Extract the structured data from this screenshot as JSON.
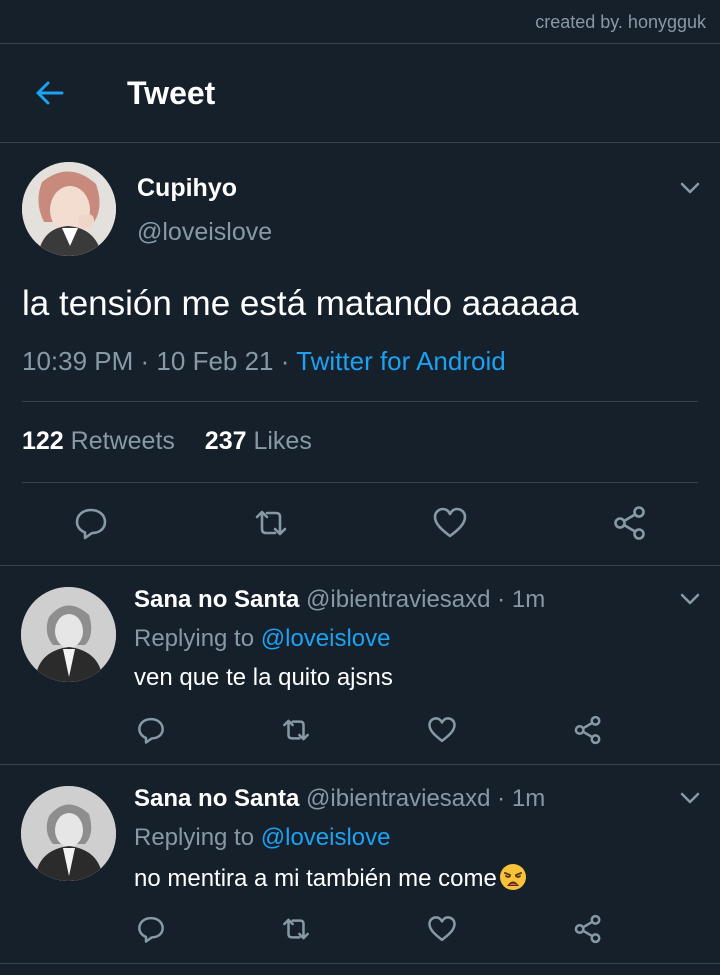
{
  "credit": "created by. honygguk",
  "header": {
    "title": "Tweet"
  },
  "tweet": {
    "name": "Cupihyo",
    "handle": "@loveislove",
    "text": "la tensión me está matando aaaaaa",
    "time": "10:39 PM",
    "date": "10 Feb 21",
    "source": "Twitter for Android",
    "retweet_count": "122",
    "retweet_label": "Retweets",
    "like_count": "237",
    "like_label": "Likes"
  },
  "replies": [
    {
      "name": "Sana no Santa",
      "handle": "@ibientraviesaxd",
      "time": "1m",
      "replying_label": "Replying to",
      "mention": "@loveislove",
      "text": "ven que te la quito ajsns"
    },
    {
      "name": "Sana no Santa",
      "handle": "@ibientraviesaxd",
      "time": "1m",
      "replying_label": "Replying to",
      "mention": "@loveislove",
      "text": "no mentira a mi también me come",
      "emoji": "weary-face-emoji"
    }
  ],
  "colors": {
    "background": "#15202b",
    "accent": "#1da1f2",
    "muted": "#8899a6",
    "divider": "#38444d"
  }
}
